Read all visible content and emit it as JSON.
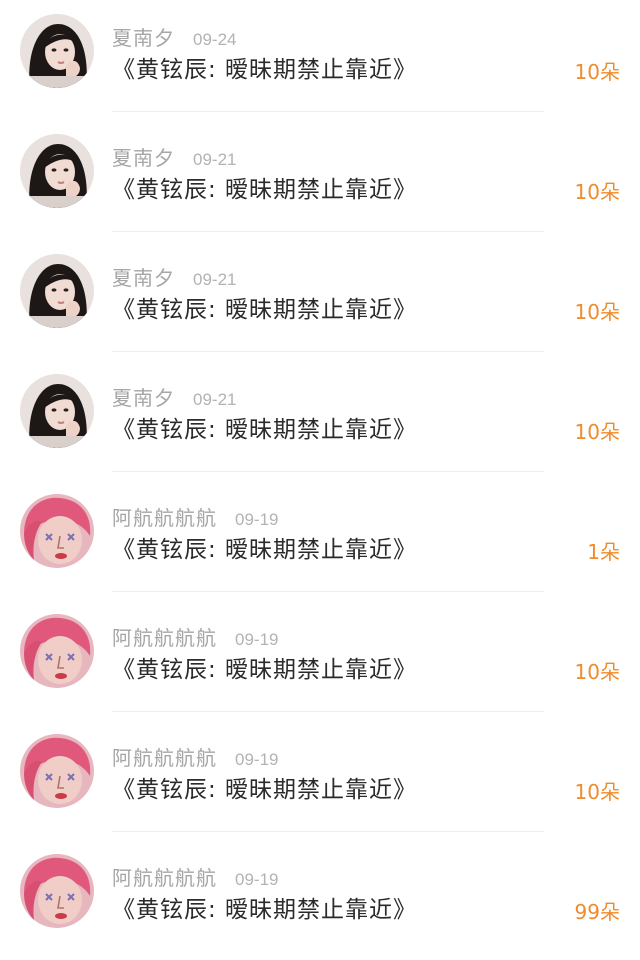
{
  "gifts": [
    {
      "user": "夏南夕",
      "date": "09-24",
      "title": "《黄铉辰: 暧昧期禁止靠近》",
      "count": "10朵",
      "avatar_icon": "dark-hair-avatar-icon"
    },
    {
      "user": "夏南夕",
      "date": "09-21",
      "title": "《黄铉辰: 暧昧期禁止靠近》",
      "count": "10朵",
      "avatar_icon": "dark-hair-avatar-icon"
    },
    {
      "user": "夏南夕",
      "date": "09-21",
      "title": "《黄铉辰: 暧昧期禁止靠近》",
      "count": "10朵",
      "avatar_icon": "dark-hair-avatar-icon"
    },
    {
      "user": "夏南夕",
      "date": "09-21",
      "title": "《黄铉辰: 暧昧期禁止靠近》",
      "count": "10朵",
      "avatar_icon": "dark-hair-avatar-icon"
    },
    {
      "user": "阿航航航航",
      "date": "09-19",
      "title": "《黄铉辰: 暧昧期禁止靠近》",
      "count": "1朵",
      "avatar_icon": "pink-hair-avatar-icon"
    },
    {
      "user": "阿航航航航",
      "date": "09-19",
      "title": "《黄铉辰: 暧昧期禁止靠近》",
      "count": "10朵",
      "avatar_icon": "pink-hair-avatar-icon"
    },
    {
      "user": "阿航航航航",
      "date": "09-19",
      "title": "《黄铉辰: 暧昧期禁止靠近》",
      "count": "10朵",
      "avatar_icon": "pink-hair-avatar-icon"
    },
    {
      "user": "阿航航航航",
      "date": "09-19",
      "title": "《黄铉辰: 暧昧期禁止靠近》",
      "count": "99朵",
      "avatar_icon": "pink-hair-avatar-icon"
    }
  ],
  "colors": {
    "username": "#a6a6a6",
    "date": "#b3b3b3",
    "title": "#2b2b2b",
    "count": "#f08a2b",
    "divider": "#eeeeee"
  }
}
